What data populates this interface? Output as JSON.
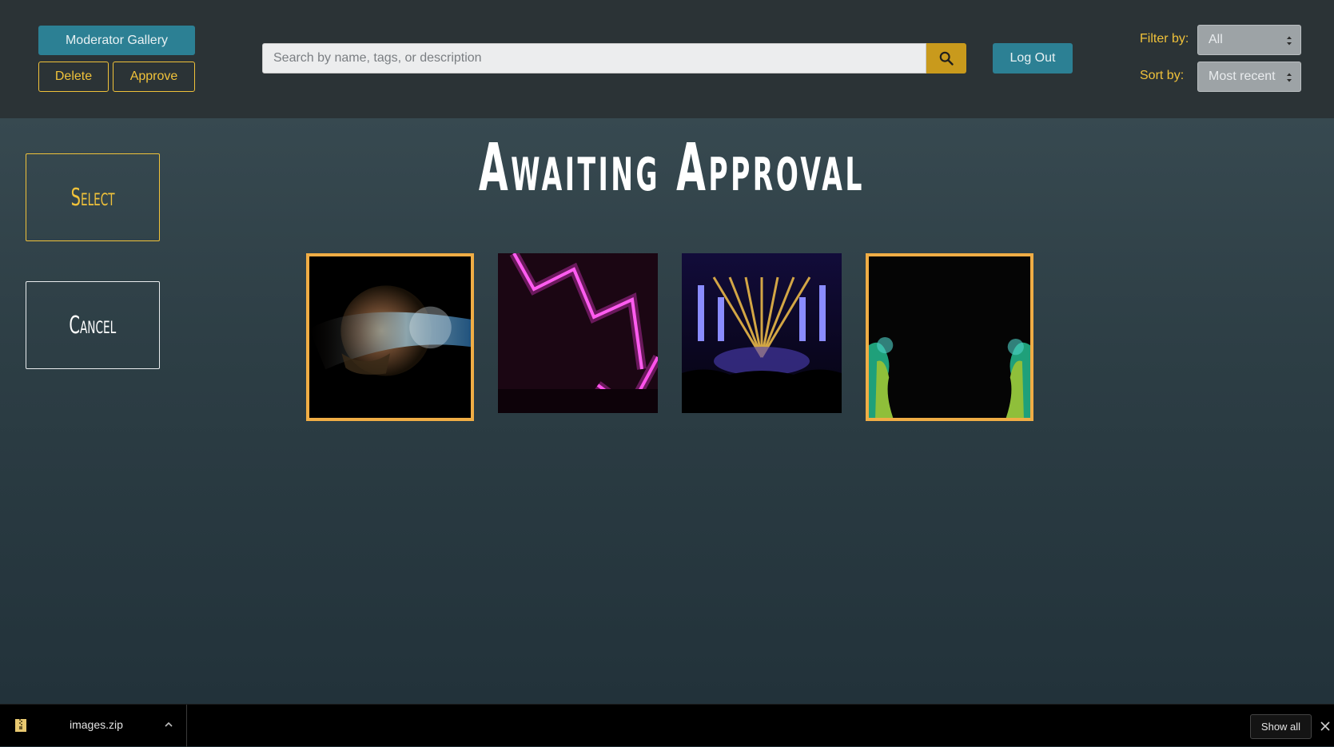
{
  "header": {
    "moderator_gallery_label": "Moderator Gallery",
    "delete_label": "Delete",
    "approve_label": "Approve",
    "search_placeholder": "Search by name, tags, or description",
    "search_icon": "search-icon",
    "logout_label": "Log Out",
    "filter_label": "Filter by:",
    "filter_value": "All",
    "sort_label": "Sort by:",
    "sort_value": "Most recent"
  },
  "sidebar": {
    "select_label": "Select",
    "cancel_label": "Cancel"
  },
  "main": {
    "title": "Awaiting Approval",
    "gallery": [
      {
        "name": "planet-hand-image",
        "selected": true
      },
      {
        "name": "neon-arrow-image",
        "selected": false
      },
      {
        "name": "concert-stage-image",
        "selected": false
      },
      {
        "name": "nebula-pillars-image",
        "selected": true
      }
    ]
  },
  "download_bar": {
    "file_name": "images.zip",
    "file_icon": "zip-file-icon",
    "show_all_label": "Show all"
  },
  "colors": {
    "accent_gold": "#f0c23a",
    "teal": "#2c8094",
    "selected_border": "#f0ad45",
    "header_bg": "#2b3336"
  }
}
